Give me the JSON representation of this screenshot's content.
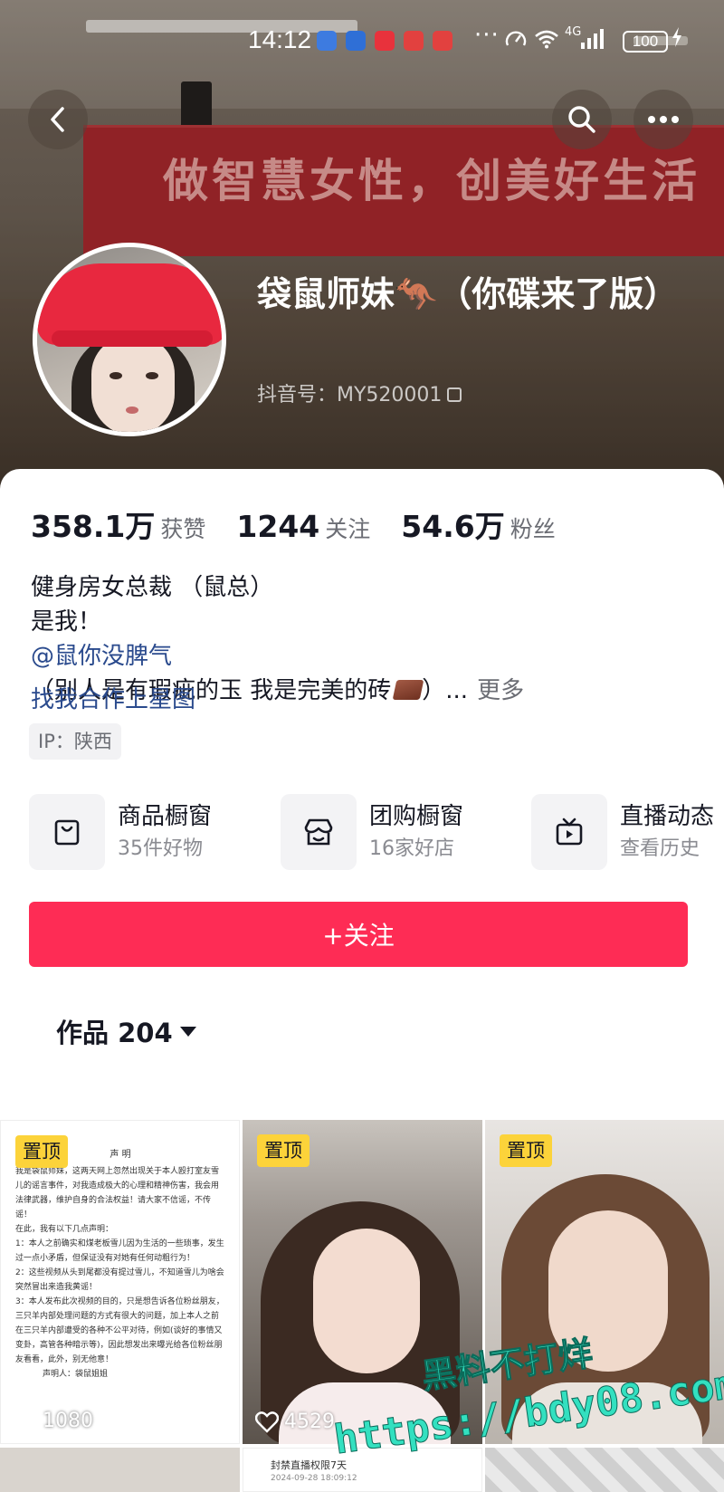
{
  "status_bar": {
    "time": "14:12",
    "more": "···",
    "network": "4G",
    "battery": "100"
  },
  "banner": {
    "slogan": "做智慧女性，创美好生活"
  },
  "profile": {
    "name": "袋鼠师妹🦘（你碟来了版）",
    "douyin_id": "抖音号：MY520001"
  },
  "stats": [
    {
      "value": "358.1万",
      "label": "获赞"
    },
    {
      "value": "1244",
      "label": "关注"
    },
    {
      "value": "54.6万",
      "label": "粉丝"
    }
  ],
  "bio": {
    "line1": "健身房女总裁 （鼠总）",
    "line2": "是我！",
    "mention": "@鼠你没脾气",
    "line4": "（别人是有瑕疵的玉 我是完美的砖",
    "line4_end": "）...",
    "more": "更多",
    "link": "找我合作上星图"
  },
  "ip_tag": "IP：陕西",
  "services": [
    {
      "title": "商品橱窗",
      "subtitle": "35件好物",
      "icon": "bag-icon"
    },
    {
      "title": "团购橱窗",
      "subtitle": "16家好店",
      "icon": "store-icon"
    },
    {
      "title": "直播动态",
      "subtitle": "查看历史",
      "icon": "tv-icon"
    }
  ],
  "follow_button": "+关注",
  "works_tab": "作品 204",
  "videos": [
    {
      "pinned": "置顶",
      "likes": "1080",
      "doc_title": "声 明",
      "doc_lines": [
        "我是袋鼠师妹，这两天网上忽然出现关于本人殴打室友雪儿的谣言事件，对我造成极大的心理和精神伤害，我会用法律武器，维护自身的合法权益！请大家不信谣，不传谣！",
        "在此，我有以下几点声明：",
        "1：本人之前确实和煤老板雪儿因为生活的一些琐事，发生过一点小矛盾，但保证没有对她有任何动粗行为！",
        "2：这些视频从头到尾都没有提过雪儿，不知道雪儿为啥会突然冒出来造我黄谣！",
        "3：本人发布此次视频的目的，只是想告诉各位粉丝朋友，三只羊内部处理问题的方式有很大的问题，加上本人之前在三只羊内部遭受的各种不公平对待，例如(谈好的事情又变卦，高管各种暗示等)，因此想发出来曝光给各位粉丝朋友看看，此外，别无他意！",
        "声明人：袋鼠姐姐"
      ]
    },
    {
      "pinned": "置顶",
      "likes": "4529"
    },
    {
      "pinned": "置顶",
      "likes": ""
    }
  ],
  "row2": {
    "doc_title": "封禁直播权限7天",
    "doc_date": "2024-09-28 18:09:12"
  },
  "watermark": {
    "line1": "黑料不打烊",
    "line2": "https://bdy08.com"
  }
}
